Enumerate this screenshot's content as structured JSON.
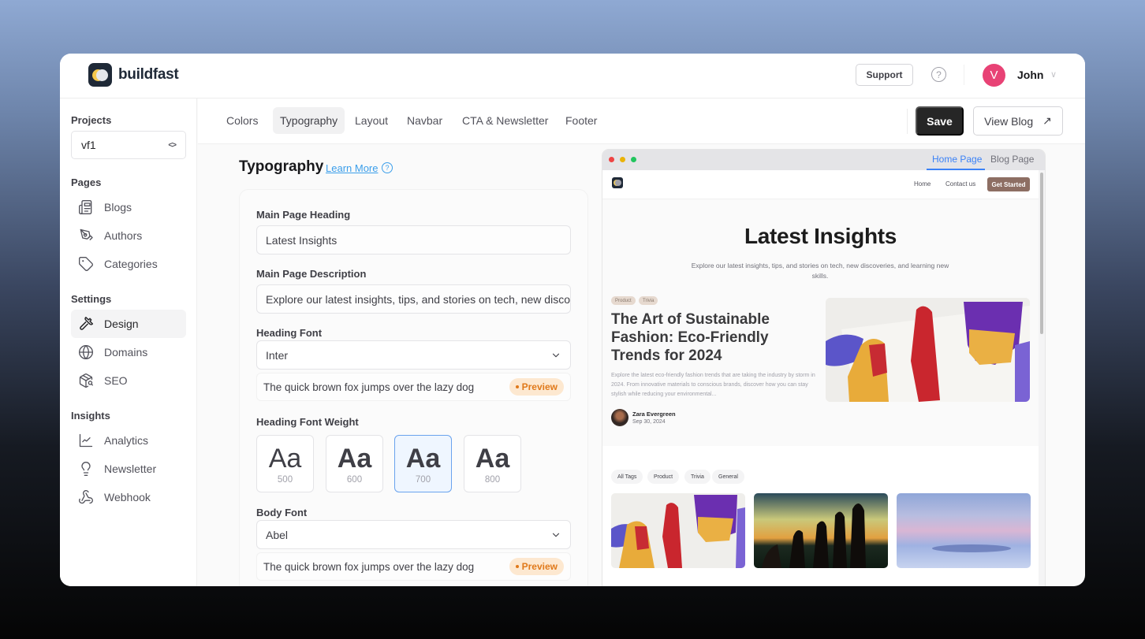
{
  "header": {
    "brand": "buildfast",
    "support_label": "Support",
    "help_icon": "?",
    "user": {
      "initial": "V",
      "name": "John",
      "avatar_color": "#e84275"
    }
  },
  "sidebar": {
    "projects_title": "Projects",
    "project_value": "vf1",
    "sections": [
      {
        "title": "Pages",
        "items": [
          {
            "label": "Blogs",
            "icon": "newspaper-icon"
          },
          {
            "label": "Authors",
            "icon": "pen-nib-icon"
          },
          {
            "label": "Categories",
            "icon": "tag-icon"
          }
        ]
      },
      {
        "title": "Settings",
        "items": [
          {
            "label": "Design",
            "icon": "paintbrush-icon",
            "active": true
          },
          {
            "label": "Domains",
            "icon": "globe-icon"
          },
          {
            "label": "SEO",
            "icon": "package-search-icon"
          }
        ]
      },
      {
        "title": "Insights",
        "items": [
          {
            "label": "Analytics",
            "icon": "line-chart-icon"
          },
          {
            "label": "Newsletter",
            "icon": "lightbulb-icon"
          },
          {
            "label": "Webhook",
            "icon": "webhook-icon"
          }
        ]
      }
    ]
  },
  "tabs": {
    "items": [
      "Colors",
      "Typography",
      "Layout",
      "Navbar",
      "CTA & Newsletter",
      "Footer"
    ],
    "active": "Typography",
    "save_label": "Save",
    "view_blog_label": "View Blog",
    "view_blog_icon": "↗"
  },
  "panel": {
    "title": "Typography",
    "learn_more": "Learn More",
    "fields": {
      "main_heading_label": "Main Page Heading",
      "main_heading_value": "Latest Insights",
      "main_desc_label": "Main Page Description",
      "main_desc_value": "Explore our latest insights, tips, and stories on tech, new discoveries, and learning new skills.",
      "heading_font_label": "Heading Font",
      "heading_font_value": "Inter",
      "heading_preview_text": "The quick brown fox jumps over the lazy dog",
      "preview_badge": "Preview",
      "heading_weight_label": "Heading Font Weight",
      "weights": [
        {
          "sample": "Aa",
          "value": "500"
        },
        {
          "sample": "Aa",
          "value": "600"
        },
        {
          "sample": "Aa",
          "value": "700",
          "selected": true
        },
        {
          "sample": "Aa",
          "value": "800"
        }
      ],
      "body_font_label": "Body Font",
      "body_font_value": "Abel",
      "body_preview_text": "The quick brown fox jumps over the lazy dog"
    }
  },
  "preview": {
    "tabs": [
      "Home Page",
      "Blog Page"
    ],
    "active_tab": "Home Page",
    "nav_links": [
      "Home",
      "Contact us"
    ],
    "cta_label": "Get Started",
    "hero_title": "Latest Insights",
    "hero_desc": "Explore our latest insights, tips, and stories on tech, new discoveries, and learning new skills.",
    "featured": {
      "tags": [
        "Product",
        "Trivia"
      ],
      "title": "The Art of Sustainable Fashion: Eco-Friendly Trends for 2024",
      "excerpt": "Explore the latest eco-friendly fashion trends that are taking the industry by storm in 2024. From innovative materials to conscious brands, discover how you can stay stylish while reducing your environmental...",
      "author": "Zara Evergreen",
      "date": "Sep 30, 2024"
    },
    "filter_chips": [
      "All Tags",
      "Product",
      "Trivia",
      "General"
    ],
    "colors": {
      "accent": "#3b82f6",
      "cta": "#8d6e63",
      "tag_bg": "#e6d9cf"
    }
  }
}
